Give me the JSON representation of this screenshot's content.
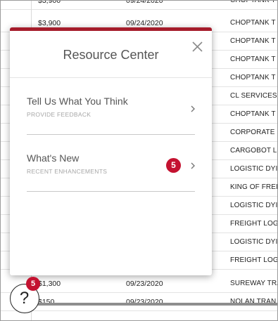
{
  "table": {
    "rows": [
      {
        "amount": "$3,900",
        "date": "09/24/2020",
        "company": "CHOPTANK T"
      },
      {
        "amount": "$3,900",
        "date": "09/24/2020",
        "company": "CHOPTANK T"
      },
      {
        "amount": "",
        "date": "",
        "company": "CHOPTANK T"
      },
      {
        "amount": "",
        "date": "",
        "company": "CHOPTANK T"
      },
      {
        "amount": "",
        "date": "",
        "company": "CHOPTANK T"
      },
      {
        "amount": "",
        "date": "",
        "company": "CL SERVICES"
      },
      {
        "amount": "",
        "date": "",
        "company": "CHOPTANK T"
      },
      {
        "amount": "",
        "date": "",
        "company": "CORPORATE"
      },
      {
        "amount": "",
        "date": "",
        "company": "CARGOBOT L"
      },
      {
        "amount": "",
        "date": "",
        "company": "LOGISTIC DYI"
      },
      {
        "amount": "",
        "date": "",
        "company": "KING OF FREI"
      },
      {
        "amount": "",
        "date": "",
        "company": "LOGISTIC DYI"
      },
      {
        "amount": "",
        "date": "",
        "company": "FREIGHT LOG"
      },
      {
        "amount": "",
        "date": "",
        "company": "LOGISTIC DYI"
      },
      {
        "amount": "",
        "date": "",
        "company": "FREIGHT LOG"
      },
      {
        "amount": "$1,300",
        "date": "09/23/2020",
        "company": "SUREWAY TRA"
      },
      {
        "amount": "$150",
        "date": "09/23/2020",
        "company": "NOLAN TRAN"
      }
    ]
  },
  "resource_center": {
    "title": "Resource Center",
    "close_icon": "close-icon",
    "items": [
      {
        "title": "Tell Us What You Think",
        "subtitle": "PROVIDE FEEDBACK",
        "icon": "chevron-right-icon"
      },
      {
        "title": "What's New",
        "subtitle": "RECENT ENHANCEMENTS",
        "badge": "5",
        "icon": "chevron-right-icon"
      }
    ]
  },
  "launcher": {
    "glyph": "?",
    "badge": "5",
    "icon": "help-icon"
  },
  "colors": {
    "accent": "#a51c2b",
    "badge": "#c41230"
  }
}
